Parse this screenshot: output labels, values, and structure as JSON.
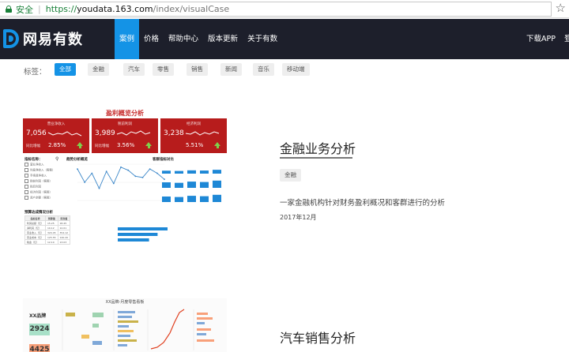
{
  "browser": {
    "secure_label": "安全",
    "url_scheme": "https://",
    "url_host": "youdata.163.com",
    "url_path": "/index/visualCase"
  },
  "nav": {
    "brand": "网易有数",
    "items": [
      {
        "label": "案例",
        "active": true
      },
      {
        "label": "价格",
        "active": false
      },
      {
        "label": "帮助中心",
        "active": false
      },
      {
        "label": "版本更新",
        "active": false
      },
      {
        "label": "关于有数",
        "active": false
      }
    ],
    "download_app": "下载APP",
    "right_cut": "登"
  },
  "tags": {
    "label": "标签：",
    "items": [
      {
        "label": "全部",
        "active": true
      },
      {
        "label": "金融",
        "active": false
      },
      {
        "label": "汽车",
        "active": false
      },
      {
        "label": "零售",
        "active": false
      },
      {
        "label": "销售",
        "active": false
      },
      {
        "label": "新闻",
        "active": false
      },
      {
        "label": "音乐",
        "active": false
      },
      {
        "label": "移动端",
        "active": false
      }
    ]
  },
  "cases": [
    {
      "title": "金融业务分析",
      "tag": "金融",
      "description": "一家金融机构针对财务盈利概况和客群进行的分析",
      "date": "2017年12月",
      "thumbnail": {
        "title": "盈利概览分析",
        "kpis": [
          {
            "label": "营业净收入",
            "value": "7,056",
            "sub": "同比增幅",
            "pct": "2.85%"
          },
          {
            "label": "税前利润",
            "value": "3,989",
            "sub": "同比增幅",
            "pct": "3.56%"
          },
          {
            "label": "经济利润",
            "value": "3,238",
            "sub": "",
            "pct": "5.51%"
          }
        ],
        "filter_title": "指标名称：",
        "filters": [
          "营业净收入",
          "利息净收入（客群）",
          "手续费净收入",
          "税前利润（客群）",
          "税后利润",
          "经济利润（客群）",
          "资产余额（客群）"
        ],
        "trend_title": "趋势分析概览",
        "trend_values": [
          52,
          30,
          45,
          20,
          48,
          28,
          55,
          50,
          40,
          38,
          52,
          45,
          35
        ],
        "segment_title": "客群指标对比",
        "segment_values": [
          55,
          50,
          62,
          58,
          72
        ],
        "table_title": "预算达成情况分析",
        "table_headers": [
          "指标名称",
          "预算值",
          "实际值"
        ],
        "table_rows": [
          [
            "利润总额（亿）",
            "15.25",
            "18.45"
          ],
          [
            "净利润（亿）",
            "10.12",
            "12.01"
          ],
          [
            "营业收入（亿）",
            "320.45",
            "354.12"
          ],
          [
            "营业成本（亿）",
            "125.55",
            "140.20"
          ],
          [
            "税金（亿）",
            "12.10",
            "13.03"
          ]
        ],
        "bar_values": [
          35,
          28,
          22
        ]
      }
    },
    {
      "title": "汽车销售分析",
      "thumbnail": {
        "title": "XX品牌-月度零售看板",
        "brand_label": "XX品牌",
        "kpi_1": "2924",
        "kpi_2": "4425"
      }
    }
  ],
  "colors": {
    "accent": "#1493e6",
    "nav_bg": "#1d1f2b",
    "kpi_red": "#b71c1c",
    "secure_green": "#188038"
  }
}
